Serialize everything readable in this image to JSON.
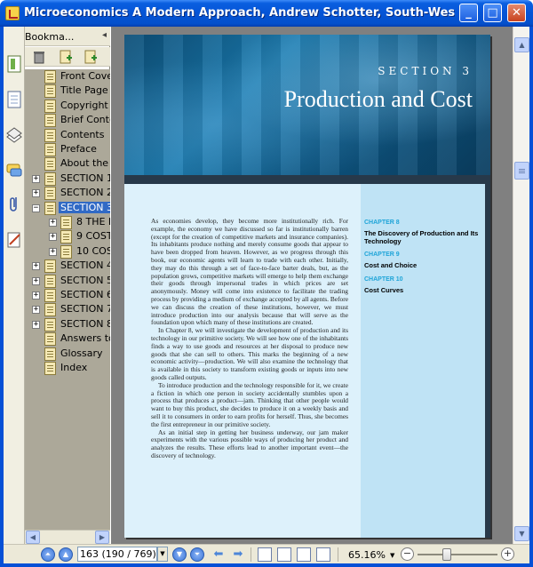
{
  "window": {
    "title": "Microeconomics A Modern Approach, Andrew Schotter, South-West...",
    "minimize": "_",
    "maximize": "□",
    "close": "✕"
  },
  "bookmarks": {
    "panel_title": "Bookma...",
    "collapse": "◂",
    "items": [
      {
        "label": "Front Cove",
        "toggle": "",
        "indent": 0
      },
      {
        "label": "Title Page",
        "toggle": "",
        "indent": 0
      },
      {
        "label": "Copyright",
        "toggle": "",
        "indent": 0
      },
      {
        "label": "Brief Conte",
        "toggle": "",
        "indent": 0
      },
      {
        "label": "Contents",
        "toggle": "",
        "indent": 0
      },
      {
        "label": "Preface",
        "toggle": "",
        "indent": 0
      },
      {
        "label": "About the",
        "toggle": "",
        "indent": 0
      },
      {
        "label": "SECTION 1",
        "toggle": "+",
        "indent": 0
      },
      {
        "label": "SECTION 2",
        "toggle": "+",
        "indent": 0
      },
      {
        "label": "SECTION 3",
        "toggle": "−",
        "indent": 0,
        "selected": true
      },
      {
        "label": "8 THE D",
        "toggle": "+",
        "indent": 1
      },
      {
        "label": "9 COST",
        "toggle": "+",
        "indent": 1
      },
      {
        "label": "10 COS",
        "toggle": "+",
        "indent": 1
      },
      {
        "label": "SECTION 4",
        "toggle": "+",
        "indent": 0
      },
      {
        "label": "SECTION 5",
        "toggle": "+",
        "indent": 0
      },
      {
        "label": "SECTION 6",
        "toggle": "+",
        "indent": 0
      },
      {
        "label": "SECTION 7",
        "toggle": "+",
        "indent": 0
      },
      {
        "label": "SECTION 8",
        "toggle": "+",
        "indent": 0
      },
      {
        "label": "Answers to",
        "toggle": "",
        "indent": 0
      },
      {
        "label": "Glossary",
        "toggle": "",
        "indent": 0
      },
      {
        "label": "Index",
        "toggle": "",
        "indent": 0
      }
    ]
  },
  "document": {
    "section_label": "SECTION 3",
    "section_title": "Production and Cost",
    "chapters": [
      {
        "number": "CHAPTER 8",
        "title": "The Discovery of Production and Its Technology"
      },
      {
        "number": "CHAPTER 9",
        "title": "Cost and Choice"
      },
      {
        "number": "CHAPTER 10",
        "title": "Cost Curves"
      }
    ],
    "paragraphs": [
      "As economies develop, they become more institutionally rich. For example, the economy we have discussed so far is institutionally barren (except for the creation of competitive markets and insurance companies). Its inhabitants produce nothing and merely consume goods that appear to have been dropped from heaven. However, as we progress through this book, our economic agents will learn to trade with each other. Initially, they may do this through a set of face-to-face barter deals, but, as the population grows, competitive markets will emerge to help them exchange their goods through impersonal trades in which prices are set anonymously. Money will come into existence to facilitate the trading process by providing a medium of exchange accepted by all agents. Before we can discuss the creation of these institutions, however, we must introduce production into our analysis because that will serve as the foundation upon which many of these institutions are created.",
      "In Chapter 8, we will investigate the development of production and its technology in our primitive society. We will see how one of the inhabitants finds a way to use goods and resources at her disposal to produce new goods that she can sell to others. This marks the beginning of a new economic activity—production. We will also examine the technology that is available in this society to transform existing goods or inputs into new goods called outputs.",
      "To introduce production and the technology responsible for it, we create a fiction in which one person in society accidentally stumbles upon a process that produces a product—jam. Thinking that other people would want to buy this product, she decides to produce it on a weekly basis and sell it to consumers in order to earn profits for herself. Thus, she becomes the first entrepreneur in our primitive society.",
      "As an initial step in getting her business underway, our jam maker experiments with the various possible ways of producing her product and analyzes the results. These efforts lead to another important event—the discovery of technology."
    ]
  },
  "statusbar": {
    "page_value": "163 (190 / 769)",
    "zoom_value": "65.16%",
    "zoom_minus": "−",
    "zoom_plus": "+",
    "zoom_level_percent": 65.16
  }
}
